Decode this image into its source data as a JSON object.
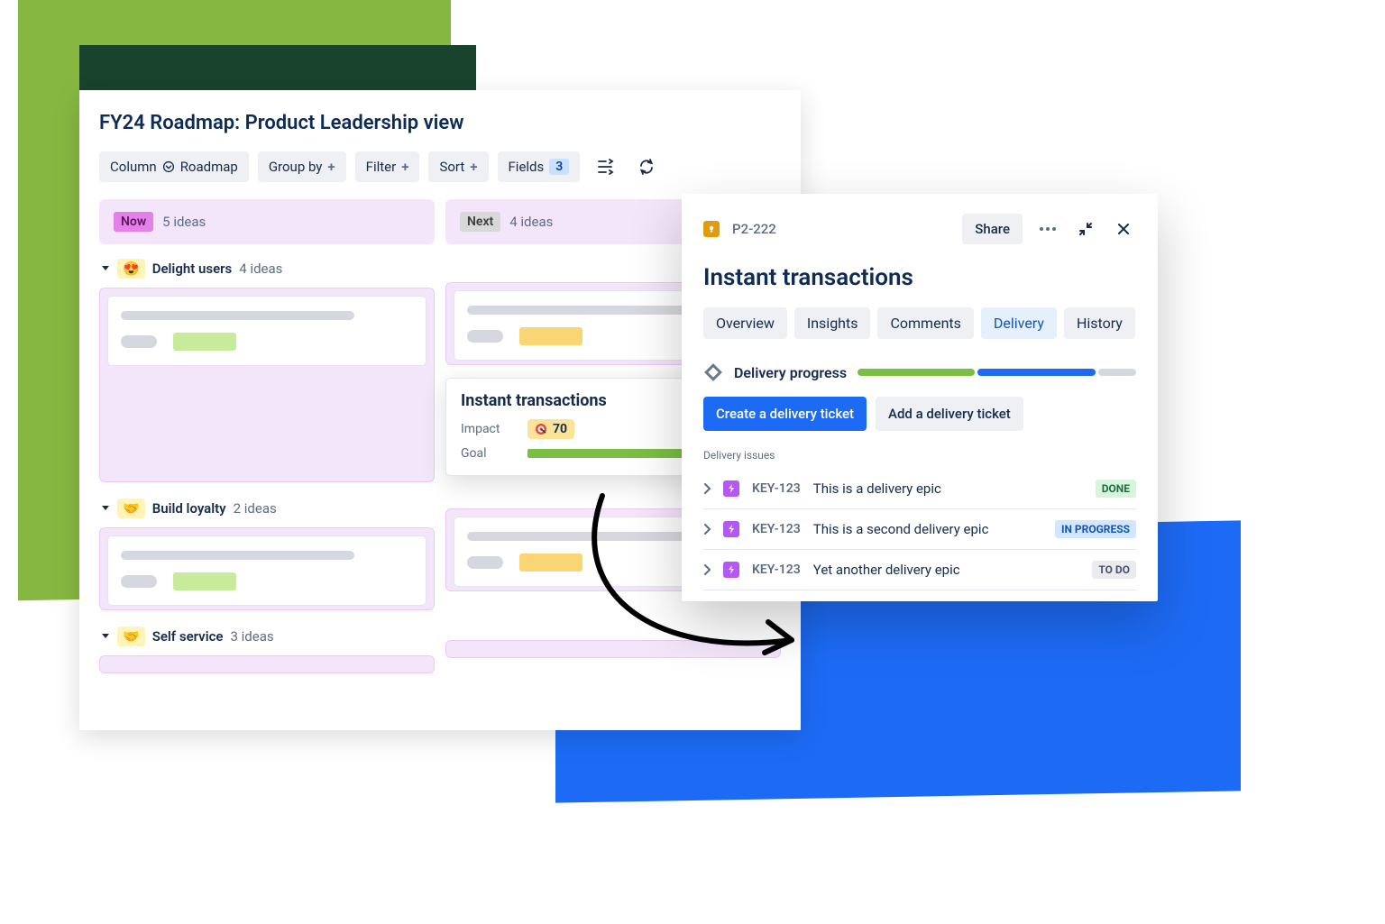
{
  "main": {
    "title": "FY24 Roadmap: Product Leadership view",
    "toolbar": {
      "column_label": "Column",
      "column_value": "Roadmap",
      "group_by": "Group by",
      "filter": "Filter",
      "sort": "Sort",
      "fields": "Fields",
      "fields_count": "3"
    },
    "columns": [
      {
        "tag": "Now",
        "subtitle": "5 ideas"
      },
      {
        "tag": "Next",
        "subtitle": "4 ideas"
      }
    ],
    "groups": [
      {
        "emoji": "😍",
        "title": "Delight users",
        "count": "4 ideas"
      },
      {
        "emoji": "🤝",
        "title": "Build loyalty",
        "count": "2 ideas"
      },
      {
        "emoji": "🤝",
        "title": "Self service",
        "count": "3 ideas"
      }
    ],
    "featured_card": {
      "title": "Instant transactions",
      "impact_label": "Impact",
      "impact_value": "70",
      "goal_label": "Goal"
    }
  },
  "panel": {
    "key": "P2-222",
    "share": "Share",
    "title": "Instant transactions",
    "tabs": [
      "Overview",
      "Insights",
      "Comments",
      "Delivery",
      "History"
    ],
    "active_tab": "Delivery",
    "delivery_progress_label": "Delivery progress",
    "buttons": {
      "create": "Create a delivery ticket",
      "add": "Add a delivery ticket"
    },
    "issues_label": "Delivery issues",
    "issues": [
      {
        "key": "KEY-123",
        "summary": "This is a delivery epic",
        "status": "DONE",
        "status_class": "st-done"
      },
      {
        "key": "KEY-123",
        "summary": "This is a second delivery epic",
        "status": "IN PROGRESS",
        "status_class": "st-prog"
      },
      {
        "key": "KEY-123",
        "summary": "Yet another delivery epic",
        "status": "TO DO",
        "status_class": "st-todo"
      }
    ]
  }
}
